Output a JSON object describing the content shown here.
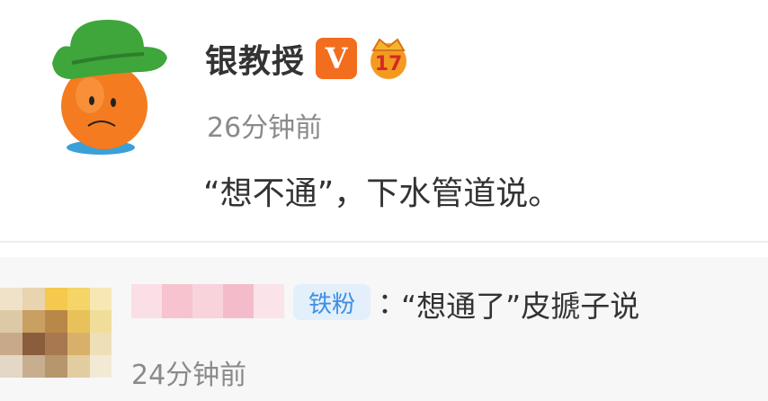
{
  "post": {
    "author_name": "银教授",
    "vip_badge": "V",
    "level_badge": "17",
    "time": "26分钟前",
    "text": "“想不通”，下水管道说。",
    "avatar_icon": "cartoon-orange-with-cowboy-hat-icon",
    "accent_color": "#f26d1e"
  },
  "comment": {
    "fan_badge": "铁粉",
    "colon": "：",
    "text": "“想通了”皮搋子说",
    "time": "24分钟前",
    "avatar_icon": "pixelated-avatar",
    "badge_color": "#3d8fe3"
  }
}
